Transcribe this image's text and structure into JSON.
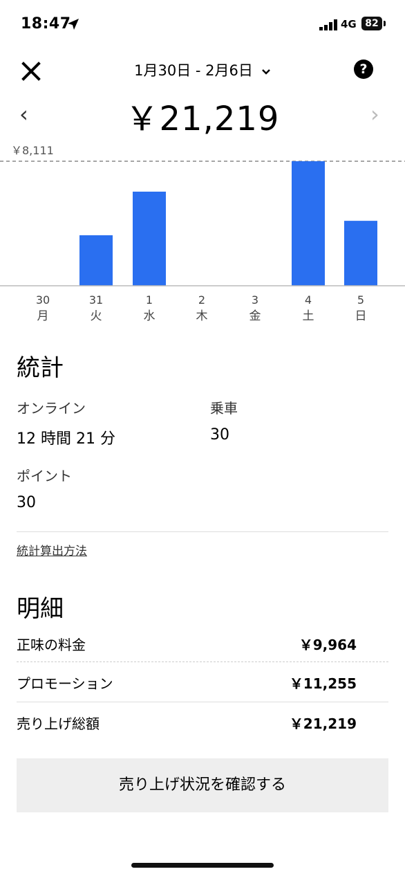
{
  "status_bar": {
    "time": "18:47",
    "network": "4G",
    "battery": "82"
  },
  "header": {
    "date_range": "1月30日 - 2月6日",
    "total": "￥21,219"
  },
  "chart_data": {
    "type": "bar",
    "categories": [
      "30\n月",
      "31\n火",
      "1\n水",
      "2\n木",
      "3\n金",
      "4\n土",
      "5\n日"
    ],
    "day_numbers": [
      "30",
      "31",
      "1",
      "2",
      "3",
      "4",
      "5"
    ],
    "weekdays": [
      "月",
      "火",
      "水",
      "木",
      "金",
      "土",
      "日"
    ],
    "values": [
      0,
      3290,
      6130,
      0,
      0,
      8111,
      4230
    ],
    "max_label": "￥8,111",
    "ylim": [
      0,
      8111
    ],
    "color": "#2a6ff0"
  },
  "stats": {
    "title": "統計",
    "online_label": "オンライン",
    "online_value": "12 時間 21 分",
    "rides_label": "乗車",
    "rides_value": "30",
    "points_label": "ポイント",
    "points_value": "30",
    "method_link": "統計算出方法"
  },
  "details": {
    "title": "明細",
    "rows": [
      {
        "label": "正味の料金",
        "value": "￥9,964"
      },
      {
        "label": "プロモーション",
        "value": "￥11,255"
      },
      {
        "label": "売り上げ総額",
        "value": "￥21,219"
      }
    ]
  },
  "action_button": "売り上げ状況を確認する"
}
